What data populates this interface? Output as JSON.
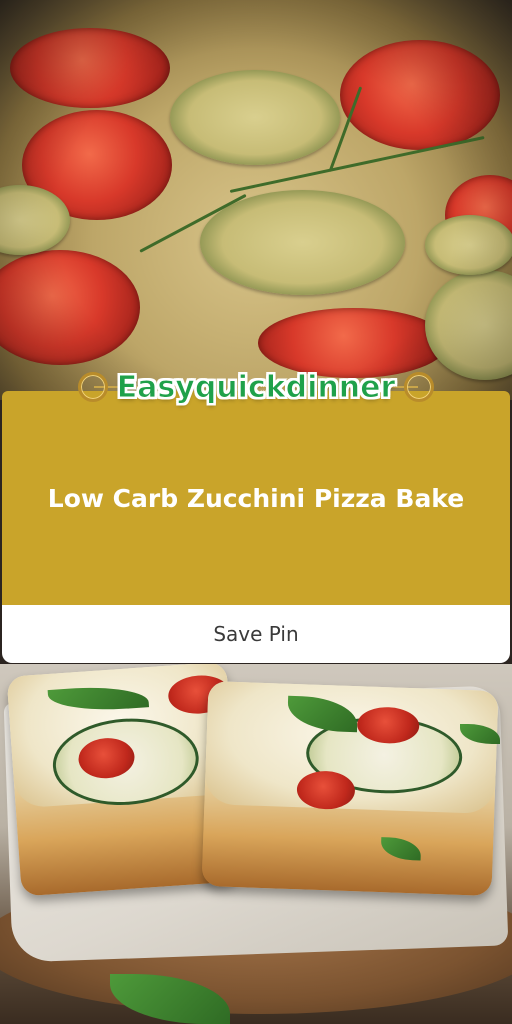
{
  "brand": {
    "name": "Easyquickdinner",
    "text_color": "#1fa14a",
    "ring_color": "#b98c2a"
  },
  "recipe": {
    "title": "Low Carb Zucchini Pizza Bake",
    "card_color": "#c9a42a"
  },
  "actions": {
    "save_pin_label": "Save Pin"
  }
}
